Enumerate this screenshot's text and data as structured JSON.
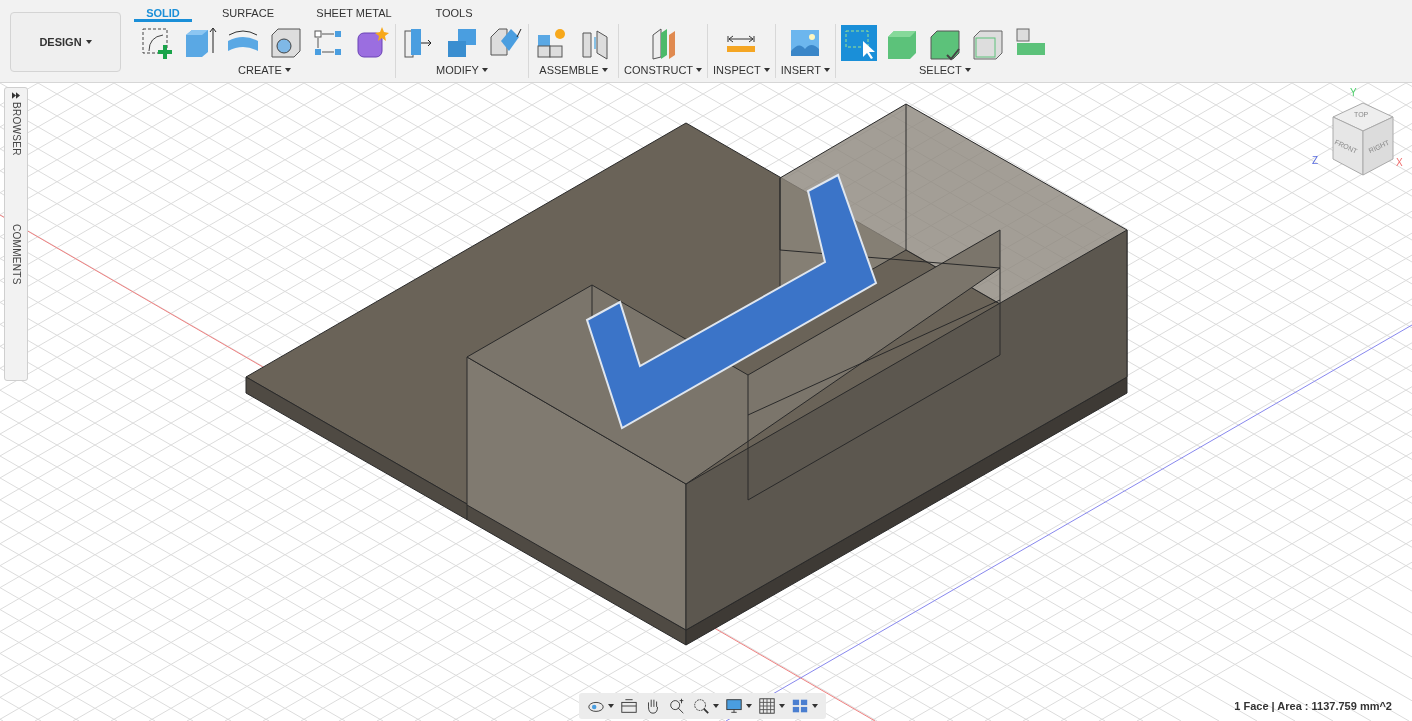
{
  "workspace": {
    "label": "DESIGN"
  },
  "tabs": [
    {
      "label": "SOLID",
      "selected": true
    },
    {
      "label": "SURFACE",
      "selected": false
    },
    {
      "label": "SHEET METAL",
      "selected": false
    },
    {
      "label": "TOOLS",
      "selected": false
    }
  ],
  "groups": [
    {
      "label": "CREATE",
      "tools": [
        {
          "kind": "sketch",
          "selected": false
        },
        {
          "kind": "extrude",
          "selected": false
        },
        {
          "kind": "revolve",
          "selected": false
        },
        {
          "kind": "hole",
          "selected": false
        },
        {
          "kind": "pattern",
          "selected": false
        },
        {
          "kind": "form",
          "selected": false
        }
      ]
    },
    {
      "label": "MODIFY",
      "tools": [
        {
          "kind": "presspull",
          "selected": false
        },
        {
          "kind": "combine",
          "selected": false
        },
        {
          "kind": "chamfer",
          "selected": false
        }
      ]
    },
    {
      "label": "ASSEMBLE",
      "tools": [
        {
          "kind": "component",
          "selected": false
        },
        {
          "kind": "joint",
          "selected": false
        }
      ]
    },
    {
      "label": "CONSTRUCT",
      "tools": [
        {
          "kind": "plane",
          "selected": false
        }
      ]
    },
    {
      "label": "INSPECT",
      "tools": [
        {
          "kind": "measure",
          "selected": false
        }
      ]
    },
    {
      "label": "INSERT",
      "tools": [
        {
          "kind": "image",
          "selected": false
        }
      ]
    },
    {
      "label": "SELECT",
      "tools": [
        {
          "kind": "window",
          "selected": true
        },
        {
          "kind": "body",
          "selected": false
        },
        {
          "kind": "checkbody",
          "selected": false
        },
        {
          "kind": "face",
          "selected": false
        },
        {
          "kind": "edge",
          "selected": false
        }
      ]
    }
  ],
  "side_panel": [
    {
      "label": "BROWSER",
      "kind": "browser"
    },
    {
      "label": "COMMENTS",
      "kind": "comments"
    }
  ],
  "view_cube": {
    "top": "TOP",
    "front": "FRONT",
    "right": "RIGHT",
    "x": "X",
    "y": "Y",
    "z": "Z"
  },
  "nav_bar": [
    {
      "kind": "orbit",
      "caret": true
    },
    {
      "kind": "lookat",
      "caret": false
    },
    {
      "kind": "pan",
      "caret": false
    },
    {
      "kind": "zoom",
      "caret": false
    },
    {
      "kind": "fit",
      "caret": true
    },
    {
      "kind": "display",
      "caret": true
    },
    {
      "kind": "grid",
      "caret": true
    },
    {
      "kind": "viewports",
      "caret": true
    }
  ],
  "status": "1 Face | Area : 1137.759 mm^2"
}
